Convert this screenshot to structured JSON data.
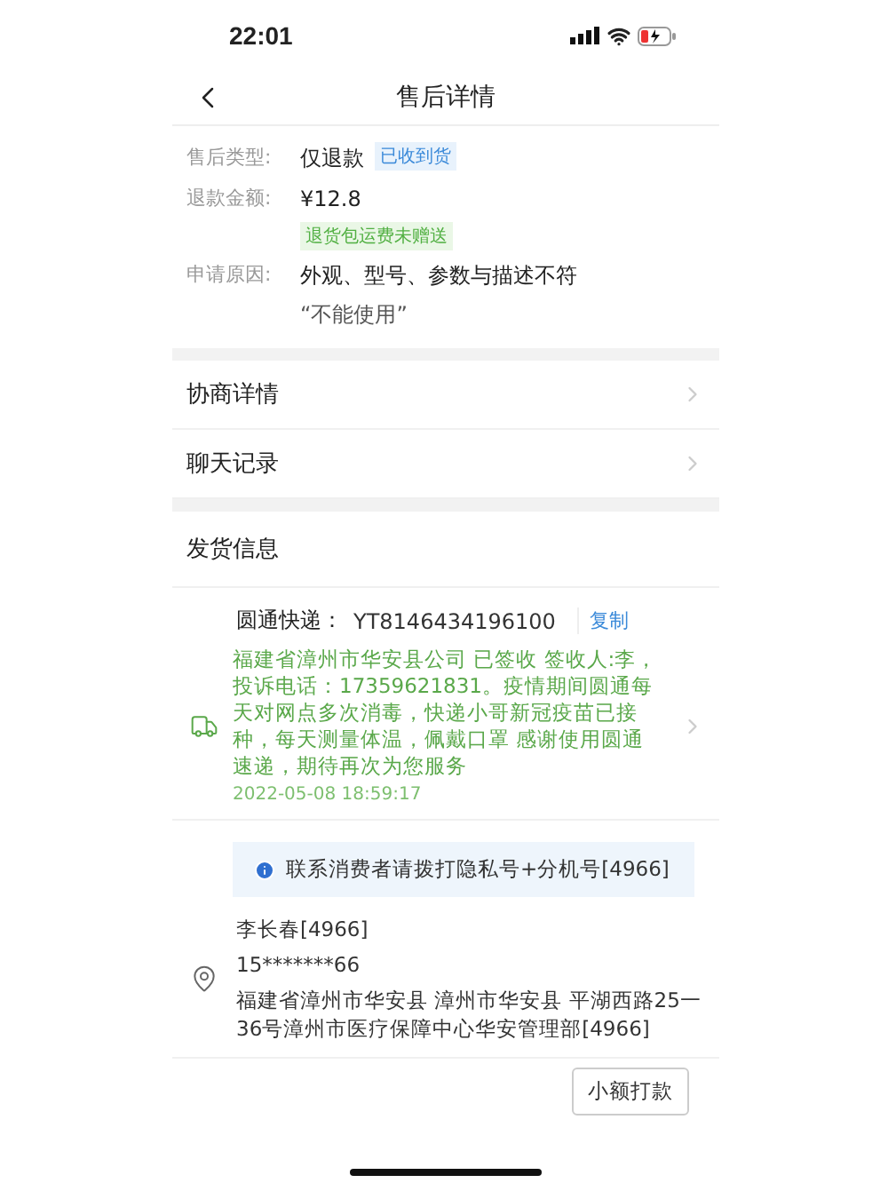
{
  "status_bar": {
    "time": "22:01"
  },
  "header": {
    "title": "售后详情"
  },
  "info_rows": [
    {
      "label": "售后类型:",
      "value": "仅退款",
      "tag": {
        "text": "已收到货",
        "kind": "blue"
      }
    },
    {
      "label": "退款金额:",
      "value": "¥12.8",
      "tag": {
        "text": "退货包运费未赠送",
        "kind": "green"
      }
    },
    {
      "label": "申请原因:",
      "value": "外观、型号、参数与描述不符",
      "note": "“不能使用”"
    }
  ],
  "nav_rows": [
    {
      "label": "协商详情"
    },
    {
      "label": "聊天记录"
    }
  ],
  "shipping": {
    "title": "发货信息",
    "carrier": "圆通快递：",
    "tracking_no": "YT8146434196100",
    "copy": "复制",
    "latest_event": "福建省漳州市华安县公司 已签收 签收人:李，投诉电话：17359621831。疫情期间圆通每天对网点多次消毒，快递小哥新冠疫苗已接种，每天测量体温，佩戴口罩 感谢使用圆通速递，期待再次为您服务",
    "event_time": "2022-05-08 18:59:17",
    "notice": "联系消费者请拨打隐私号+分机号[4966]",
    "receiver": {
      "name": "李长春[4966]",
      "phone": "15*******66",
      "address": "福建省漳州市华安县 漳州市华安县 平湖西路25一36号漳州市医疗保障中心华安管理部[4966]"
    }
  },
  "actions": [
    "小额打款"
  ]
}
